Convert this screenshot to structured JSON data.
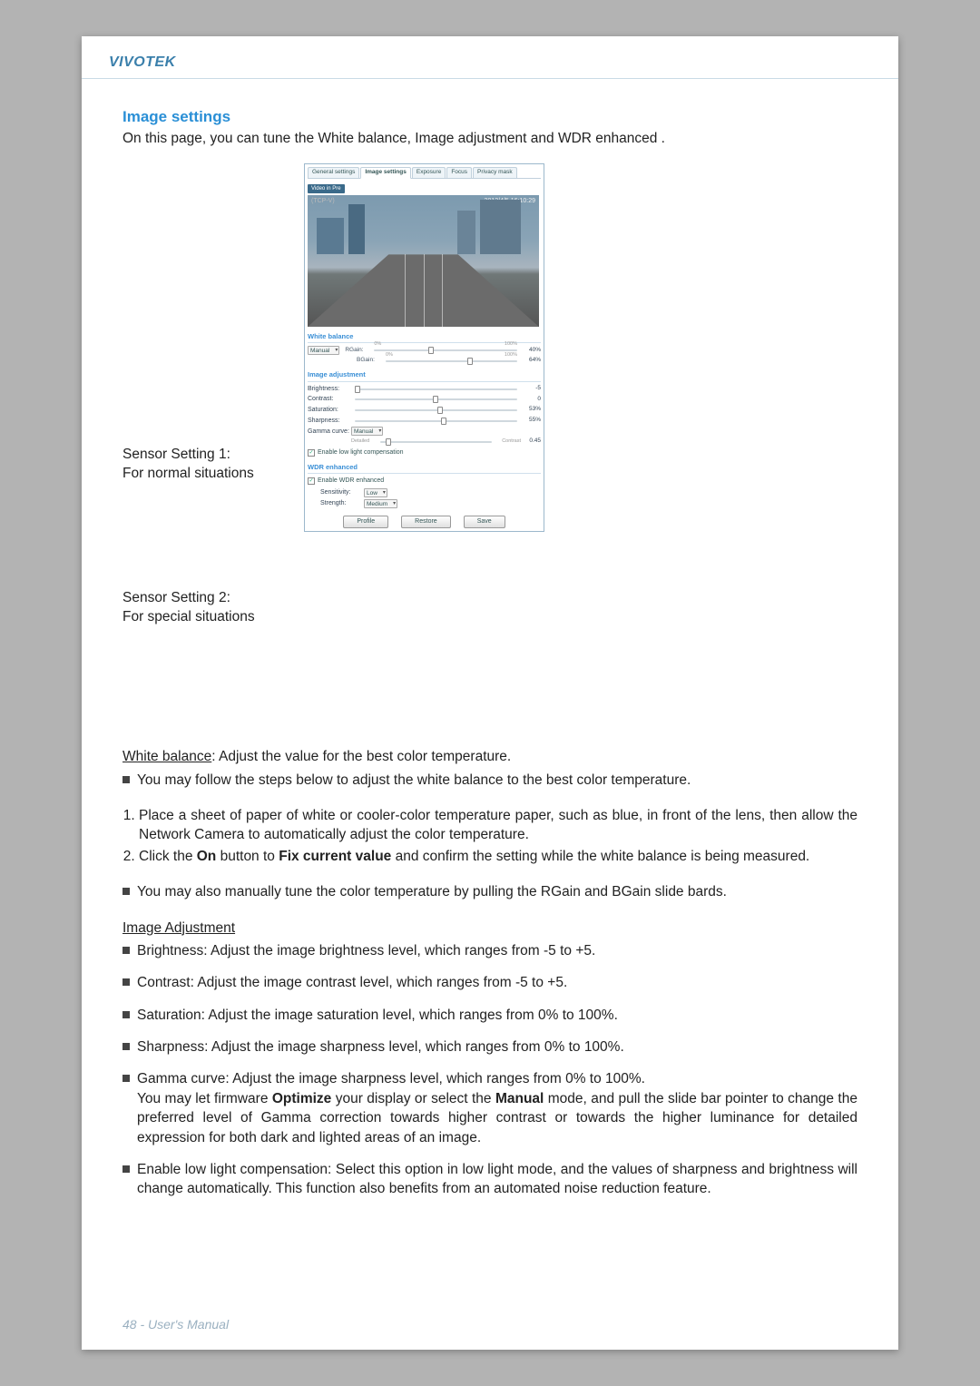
{
  "brand": "VIVOTEK",
  "section_title": "Image settings",
  "intro": "On this page, you can tune the White balance, Image adjustment and WDR enhanced .",
  "figure": {
    "label1_title": "Sensor Setting 1:",
    "label1_sub": "For normal situations",
    "label2_title": "Sensor Setting 2:",
    "label2_sub": "For special situations"
  },
  "ui": {
    "tabs": [
      "General settings",
      "Image settings",
      "Exposure",
      "Focus",
      "Privacy mask"
    ],
    "active_tab": 1,
    "badge": "Video in Pre",
    "cam_name": "(TCP-V)",
    "timestamp": "2012/4/5 16:10:29",
    "wb": {
      "head": "White balance",
      "mode_label": "",
      "mode": "Manual",
      "rgain_label": "RGain:",
      "rgain_start": "0%",
      "rgain_end": "100%",
      "rgain_val": "40%",
      "bgain_label": "BGain:",
      "bgain_start": "0%",
      "bgain_end": "100%",
      "bgain_val": "64%"
    },
    "adj": {
      "head": "Image adjustment",
      "brightness_label": "Brightness:",
      "brightness_val": "-5",
      "contrast_label": "Contrast:",
      "contrast_val": "0",
      "saturation_label": "Saturation:",
      "saturation_val": "53%",
      "sharpness_label": "Sharpness:",
      "sharpness_val": "55%",
      "gamma_label": "Gamma curve:",
      "gamma_mode": "Manual",
      "gamma_left": "Detailed",
      "gamma_right": "Contrast",
      "gamma_val": "0.45",
      "lowlight": "Enable low light compensation"
    },
    "wdr": {
      "head": "WDR enhanced",
      "enable": "Enable WDR enhanced",
      "sens_label": "Sensitivity:",
      "sens_val": "Low",
      "str_label": "Strength:",
      "str_val": "Medium"
    },
    "btn_profile": "Profile",
    "btn_restore": "Restore",
    "btn_save": "Save"
  },
  "body": {
    "wb_title": "White balance",
    "wb_desc": ": Adjust the value for the best color temperature.",
    "wb_intro": "You may follow the steps below to adjust the white balance to the best color temperature.",
    "step1": "Place a sheet of paper of white or cooler-color temperature paper, such as blue, in front of the lens, then allow the Network Camera to automatically adjust the color temperature.",
    "step2_a": "Click the ",
    "step2_b1": "On",
    "step2_c": " button to ",
    "step2_b2": "Fix current value",
    "step2_d": " and confirm the setting while the white balance is being measured.",
    "wb_manual": "You may also manually tune the color temperature by pulling the RGain and BGain slide bards.",
    "adj_title": "Image Adjustment",
    "brightness": "Brightness: Adjust the image brightness level, which ranges from -5 to +5.",
    "contrast": "Contrast: Adjust the image contrast level, which ranges from -5 to +5.",
    "saturation": "Saturation: Adjust the image saturation level, which ranges from 0% to 100%.",
    "sharpness": "Sharpness: Adjust the image sharpness level, which ranges from 0% to 100%.",
    "gamma_a": "Gamma curve: Adjust the image sharpness level, which ranges from 0% to 100%.",
    "gamma_b1": "You may let firmware ",
    "gamma_bold1": "Optimize",
    "gamma_b2": " your display or select the ",
    "gamma_bold2": "Manual",
    "gamma_b3": " mode, and pull the slide bar pointer to change the preferred level of Gamma correction towards higher contrast or towards the higher luminance for detailed expression for both dark and lighted areas of an image.",
    "lowlight": "Enable low light compensation: Select this option in low light mode, and the values of sharpness and brightness will change automatically. This function also benefits from an automated noise reduction feature."
  },
  "footer": "48 - User's Manual"
}
